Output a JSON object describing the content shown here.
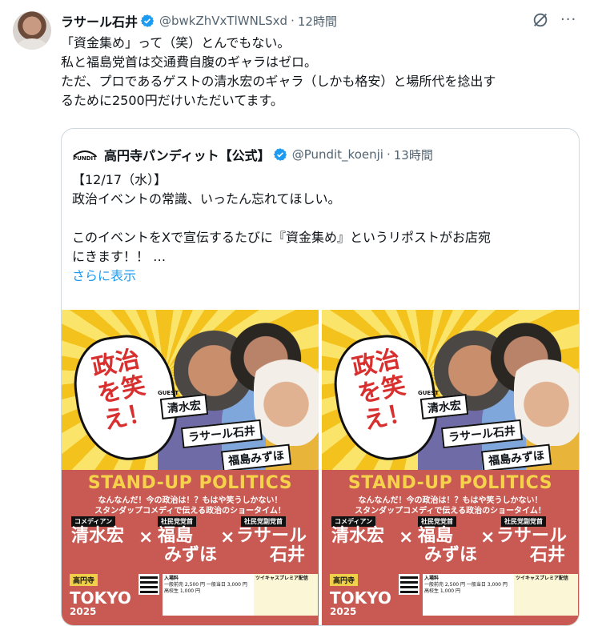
{
  "tweet": {
    "author_name": "ラサール石井",
    "handle": "@bwkZhVxTlWNLSxd",
    "time": "12時間",
    "separator": "·",
    "lines": [
      "「資金集め」って（笑）とんでもない。",
      "私と福島党首は交通費自腹のギャラはゼロ。",
      "ただ、プロであるゲストの清水宏のギャラ（しかも格安）と場所代を捻出す",
      "るために2500円だけいただいてます。"
    ]
  },
  "quote": {
    "author_name": "高円寺パンディット【公式】",
    "handle": "@Pundit_koenji",
    "time": "13時間",
    "separator": "·",
    "logo_text": "PUNDIT",
    "lines": [
      "【12/17（水）】",
      "政治イベントの常識、いったん忘れてほしい。",
      "",
      "このイベントをXで宣伝するたびに『資金集め』というリポストがお店宛",
      "にきます！！ …"
    ],
    "show_more": "さらに表示"
  },
  "poster": {
    "bubble": "政治を笑え！",
    "guest_label": "GUEST",
    "tags": [
      "清水宏",
      "ラサール石井",
      "福島みずほ"
    ],
    "title": "STAND-UP POLITICS",
    "subtitle": [
      "なんなんだ！今の政治は！？もはや笑うしかない！",
      "スタンダップコメディで伝える政治のショータイム！"
    ],
    "roles": [
      "コメディアン",
      "社民党党首",
      "社民党副党首"
    ],
    "cast": [
      "清水宏",
      "福島",
      "みずほ",
      "ラサール",
      "石井"
    ],
    "cast_sub": "ゲスト",
    "cross": "×",
    "venue": "高円寺",
    "city": "TOKYO",
    "year": "2025",
    "info_label": "入場料",
    "info_text": "一般前売 2,500 円 一般当日 3,000 円 高校生 1,000 円",
    "stream": "ツイキャスプレミア配信"
  },
  "colors": {
    "text": "#0f1419",
    "muted": "#536471",
    "link": "#1d9bf0",
    "verified": "#1d9bf0",
    "border": "#cfd9de",
    "poster_red": "#c85a53",
    "poster_yellow": "#f7d44a"
  },
  "icons": [
    "verified-badge-icon",
    "grok-icon",
    "more-icon"
  ]
}
